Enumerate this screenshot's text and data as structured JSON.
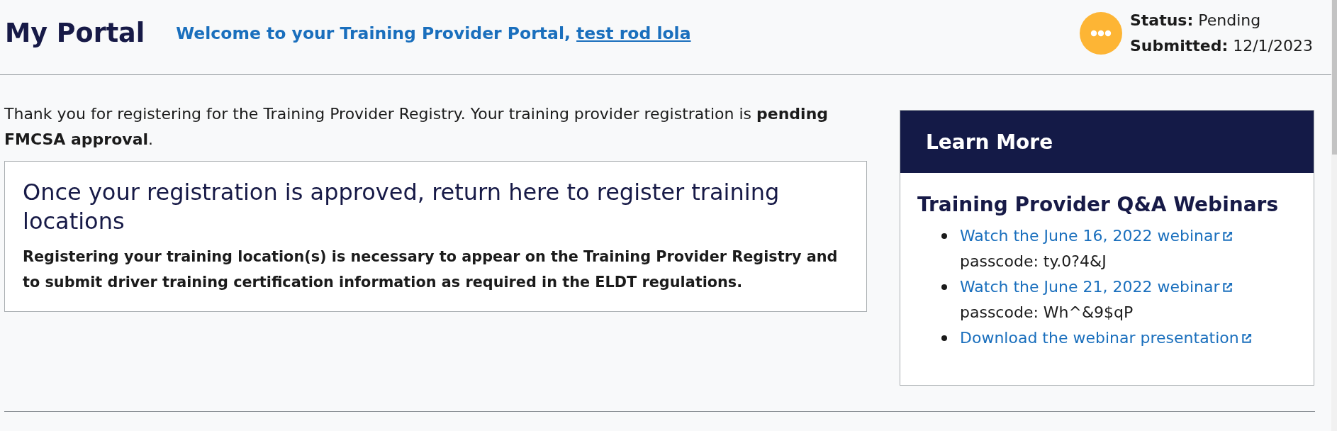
{
  "header": {
    "title": "My Portal",
    "welcome": {
      "text": "Welcome to your Training Provider Portal,",
      "link": "test rod lola"
    },
    "status": [
      "**Status:** Pending",
      "**Submitted:** 12/1/2023"
    ]
  },
  "intro": "Thank you for registering for the Training Provider Registry. Your training provider registration is **pending FMCSA approval**.",
  "notice": {
    "heading": "Once your registration is approved, return here to register training locations",
    "body": "Registering your training location(s) is necessary to appear on the Training Provider Registry and to submit driver training certification information as required in the ELDT regulations."
  },
  "learn_more": {
    "title": "Learn More",
    "heading": "Training Provider Q&A Webinars",
    "items": [
      {
        "link": "Watch the June 16, 2022 webinar",
        "passcode": "passcode: ty.0?4&J"
      },
      {
        "link": "Watch the June 21, 2022 webinar",
        "passcode": "passcode: Wh^&9$qP"
      },
      {
        "link": "Download the webinar presentation"
      }
    ]
  }
}
